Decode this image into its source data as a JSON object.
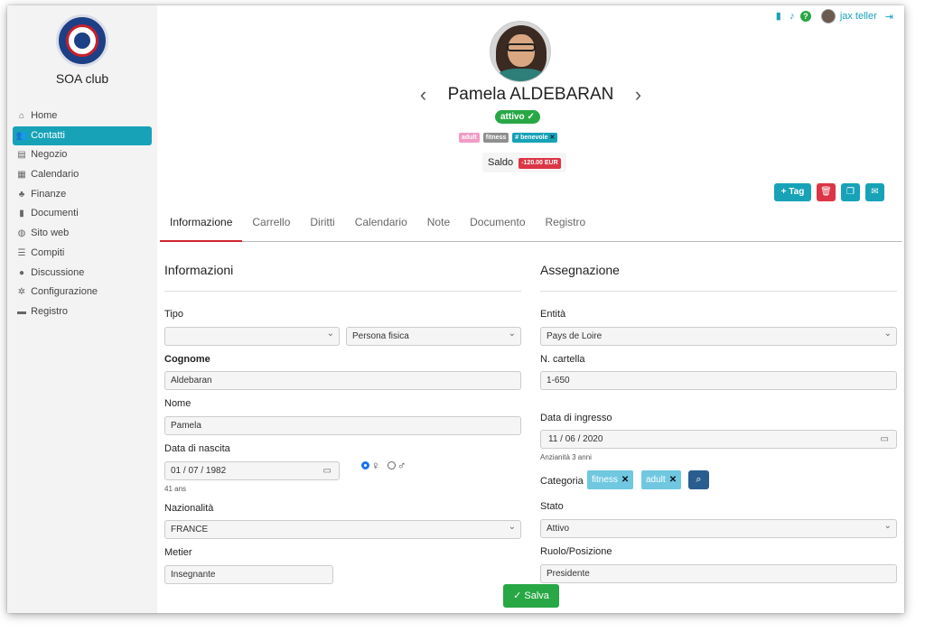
{
  "sidebar": {
    "club_name": "SOA club",
    "items": [
      {
        "label": "Home",
        "icon": "home-icon",
        "glyph": "⌂"
      },
      {
        "label": "Contatti",
        "icon": "users-icon",
        "glyph": "👥"
      },
      {
        "label": "Negozio",
        "icon": "store-icon",
        "glyph": "▤"
      },
      {
        "label": "Calendario",
        "icon": "calendar-icon",
        "glyph": "▦"
      },
      {
        "label": "Finanze",
        "icon": "piggy-bank-icon",
        "glyph": "♣"
      },
      {
        "label": "Documenti",
        "icon": "document-icon",
        "glyph": "▮"
      },
      {
        "label": "Sito web",
        "icon": "globe-icon",
        "glyph": "◍"
      },
      {
        "label": "Compiti",
        "icon": "tasks-icon",
        "glyph": "☰"
      },
      {
        "label": "Discussione",
        "icon": "discussion-icon",
        "glyph": "●"
      },
      {
        "label": "Configurazione",
        "icon": "gear-icon",
        "glyph": "✲"
      },
      {
        "label": "Registro",
        "icon": "book-icon",
        "glyph": "▬"
      }
    ],
    "active_index": 1
  },
  "topbar": {
    "user_name": "jax teller",
    "help": "?"
  },
  "profile": {
    "name": "Pamela ALDEBARAN",
    "status": "attivo ✓",
    "tags": [
      {
        "label": "adult",
        "style": "adult"
      },
      {
        "label": "fitness",
        "style": "fitness"
      },
      {
        "label": "# benevole",
        "style": "benevole",
        "removable": true
      }
    ],
    "saldo_label": "Saldo",
    "saldo_value": "-120.00 EUR"
  },
  "actions": {
    "tag_label": "+ Tag"
  },
  "tabs": [
    "Informazione",
    "Carrello",
    "Diritti",
    "Calendario",
    "Note",
    "Documento",
    "Registro"
  ],
  "info": {
    "title": "Informazioni",
    "tipo_label": "Tipo",
    "tipo_value_1": "",
    "tipo_value_2": "Persona fisica",
    "cognome_label": "Cognome",
    "cognome_value": "Aldebaran",
    "nome_label": "Nome",
    "nome_value": "Pamela",
    "nascita_label": "Data di nascita",
    "nascita_value": "01 / 07 / 1982",
    "age_hint": "41 ans",
    "nazionalita_label": "Nazionalità",
    "nazionalita_value": "FRANCE",
    "metier_label": "Metier",
    "metier_value": "Insegnante"
  },
  "assign": {
    "title": "Assegnazione",
    "entita_label": "Entità",
    "entita_value": "Pays de Loire",
    "cartella_label": "N. cartella",
    "cartella_value": "1-650",
    "ingresso_label": "Data di ingresso",
    "ingresso_value": "11 / 06 / 2020",
    "anzianita_hint": "Anzianità 3 anni",
    "categoria_label": "Categoria",
    "categorie": [
      "fitness",
      "adult"
    ],
    "stato_label": "Stato",
    "stato_value": "Attivo",
    "ruolo_label": "Ruolo/Posizione",
    "ruolo_value": "Presidente"
  },
  "footer": {
    "save_label": "✓ Salva"
  },
  "colors": {
    "accent": "#17a2b8",
    "success": "#28a745",
    "danger": "#dc3545",
    "tab_underline": "#d0242e"
  }
}
